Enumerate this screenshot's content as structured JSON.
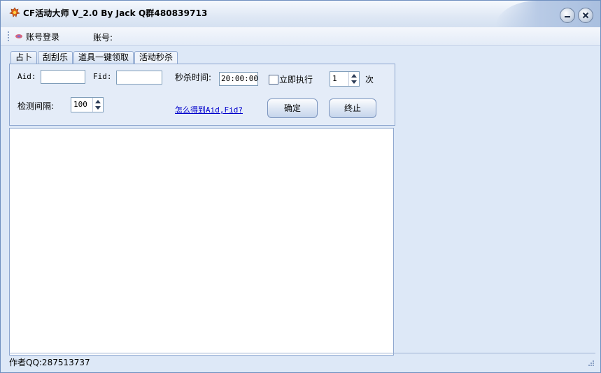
{
  "window": {
    "title": "CF活动大师 V_2.0 By Jack Q群480839713"
  },
  "toolbar": {
    "login_label": "账号登录",
    "account_label": "账号:"
  },
  "tabs": [
    {
      "label": "占卜"
    },
    {
      "label": "刮刮乐"
    },
    {
      "label": "道具一键领取"
    },
    {
      "label": "活动秒杀"
    }
  ],
  "form": {
    "aid_label": "Aid:",
    "aid_value": "",
    "fid_label": "Fid:",
    "fid_value": "",
    "seckill_time_label": "秒杀时间:",
    "seckill_time_value": "20:00:00",
    "execute_now_label": "立即执行",
    "count_value": "1",
    "count_unit": "次",
    "interval_label": "检测间隔:",
    "interval_value": "100",
    "help_link": "怎么得到Aid,Fid?",
    "confirm_label": "确定",
    "stop_label": "终止"
  },
  "log": {
    "content": ""
  },
  "status": {
    "author": "作者QQ:287513737"
  },
  "colors": {
    "window_bg": "#dde8f7",
    "border": "#8ea7cf",
    "link": "#0000cc"
  }
}
